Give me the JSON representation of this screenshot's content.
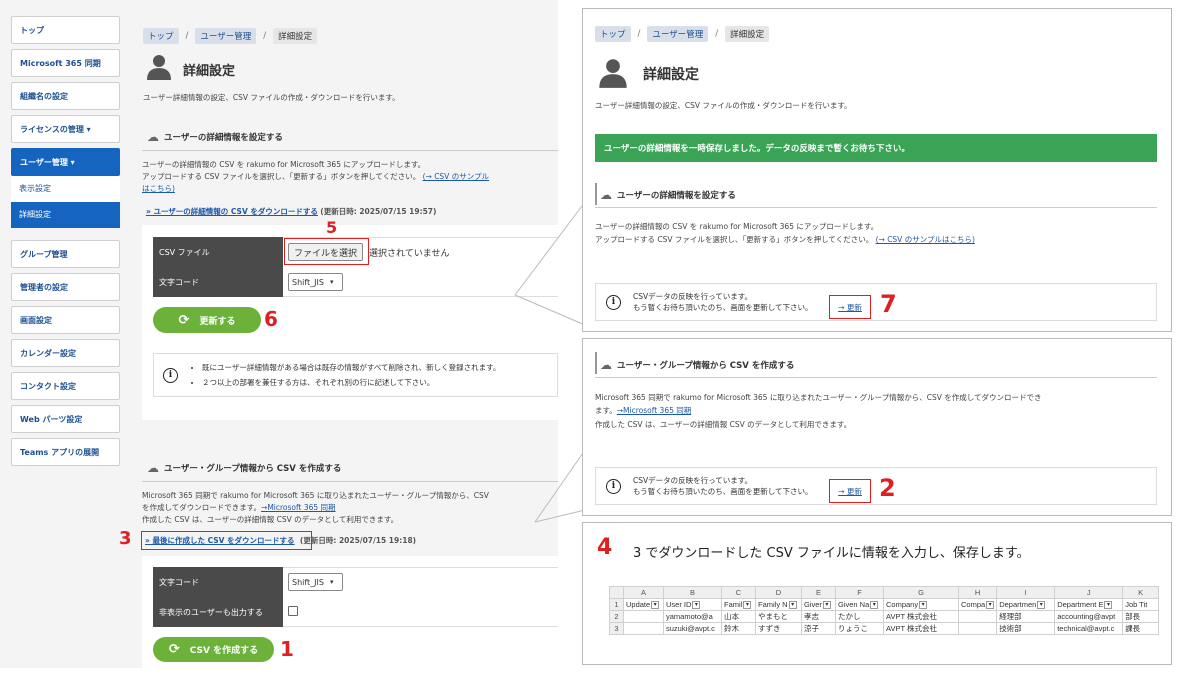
{
  "sidebar": {
    "items": [
      {
        "label": "トップ"
      },
      {
        "label": "Microsoft 365 同期"
      },
      {
        "label": "組織名の設定"
      },
      {
        "label": "ライセンスの管理 ▾"
      },
      {
        "label": "ユーザー管理 ▾"
      }
    ],
    "sub": [
      "表示設定",
      "詳細設定"
    ],
    "items2": [
      {
        "label": "グループ管理"
      },
      {
        "label": "管理者の設定"
      },
      {
        "label": "画面設定"
      },
      {
        "label": "カレンダー設定"
      },
      {
        "label": "コンタクト設定"
      },
      {
        "label": "Web パーツ設定"
      },
      {
        "label": "Teams アプリの展開"
      }
    ]
  },
  "breadcrumb": {
    "top": "トップ",
    "users": "ユーザー管理",
    "current": "詳細設定"
  },
  "page": {
    "title": "詳細設定",
    "desc": "ユーザー詳細情報の設定、CSV ファイルの作成・ダウンロードを行います。"
  },
  "upload": {
    "heading": "ユーザーの詳細情報を設定する",
    "line1": "ユーザーの詳細情報の CSV を rakumo for Microsoft 365 にアップロードします。",
    "line2": "アップロードする CSV ファイルを選択し、「更新する」ボタンを押してください。",
    "sample_link_a": "(→ CSV のサンプル",
    "sample_link_b": "はこちら)",
    "sample_link_full": "(→ CSV のサンプルはこちら)",
    "download_link": "» ユーザーの詳細情報の CSV をダウンロードする",
    "download_time": "(更新日時: 2025/07/15 19:57)",
    "csv_file_label": "CSV ファイル",
    "choose_file": "ファイルを選択",
    "no_file": "選択されていません",
    "encoding_label": "文字コード",
    "encoding_value": "Shift_JIS",
    "update_button": "更新する",
    "note1": "既にユーザー詳細情報がある場合は既存の情報がすべて削除され、新しく登録されます。",
    "note2": "２つ以上の部署を兼任する方は、それぞれ別の行に記述して下さい。"
  },
  "create": {
    "heading": "ユーザー・グループ情報から CSV を作成する",
    "line1": "Microsoft 365 同期で rakumo for Microsoft 365 に取り込まれたユーザー・グループ情報から、CSV",
    "line1b": "を作成してダウンロードできます。",
    "link": "→Microsoft 365 同期",
    "line2": "作成した CSV は、ユーザーの詳細情報 CSV のデータとして利用できます。",
    "download_link": "» 最後に作成した CSV をダウンロードする",
    "download_time": "(更新日時: 2025/07/15 19:18)",
    "encoding_label": "文字コード",
    "encoding_value": "Shift_JIS",
    "hidden_label": "非表示のユーザーも出力する",
    "create_button": "CSV を作成する",
    "r_line1": "Microsoft 365 同期で rakumo for Microsoft 365 に取り込まれたユーザー・グループ情報から、CSV を作成してダウンロードでき",
    "r_line1b": "ます。"
  },
  "right": {
    "banner": "ユーザーの詳細情報を一時保存しました。データの反映まで暫くお待ち下さい。",
    "progress1": "CSVデータの反映を行っています。",
    "progress2": "もう暫くお待ち頂いたのち、画面を更新して下さい。",
    "refresh": "→ 更新"
  },
  "step4": {
    "num": "4",
    "text": "3 でダウンロードした CSV ファイルに情報を入力し、保存します。"
  },
  "sheet": {
    "cols": [
      "A",
      "B",
      "C",
      "D",
      "E",
      "F",
      "G",
      "H",
      "I",
      "J",
      "K"
    ],
    "headers": [
      "Update",
      "User ID",
      "Famil",
      "Family N",
      "Giver",
      "Given Na",
      "Company",
      "Compa",
      "Departmen",
      "Department E",
      "Job Tit"
    ],
    "rows": [
      [
        "",
        "yamamoto@a",
        "山本",
        "やまもと",
        "孝志",
        "たかし",
        "AVPT 株式会社",
        "",
        "経理部",
        "accounting@avpt",
        "部長"
      ],
      [
        "",
        "suzuki@avpt.c",
        "鈴木",
        "すずき",
        "涼子",
        "りょうこ",
        "AVPT 株式会社",
        "",
        "技術部",
        "technical@avpt.c",
        "課長"
      ]
    ]
  },
  "steps": {
    "s1": "1",
    "s2": "2",
    "s3": "3",
    "s5": "5",
    "s6": "6",
    "s7": "7"
  },
  "colors": {
    "accent": "#1565c0",
    "button": "#6bb13a",
    "banner": "#3aa356",
    "marker": "#e02020"
  }
}
